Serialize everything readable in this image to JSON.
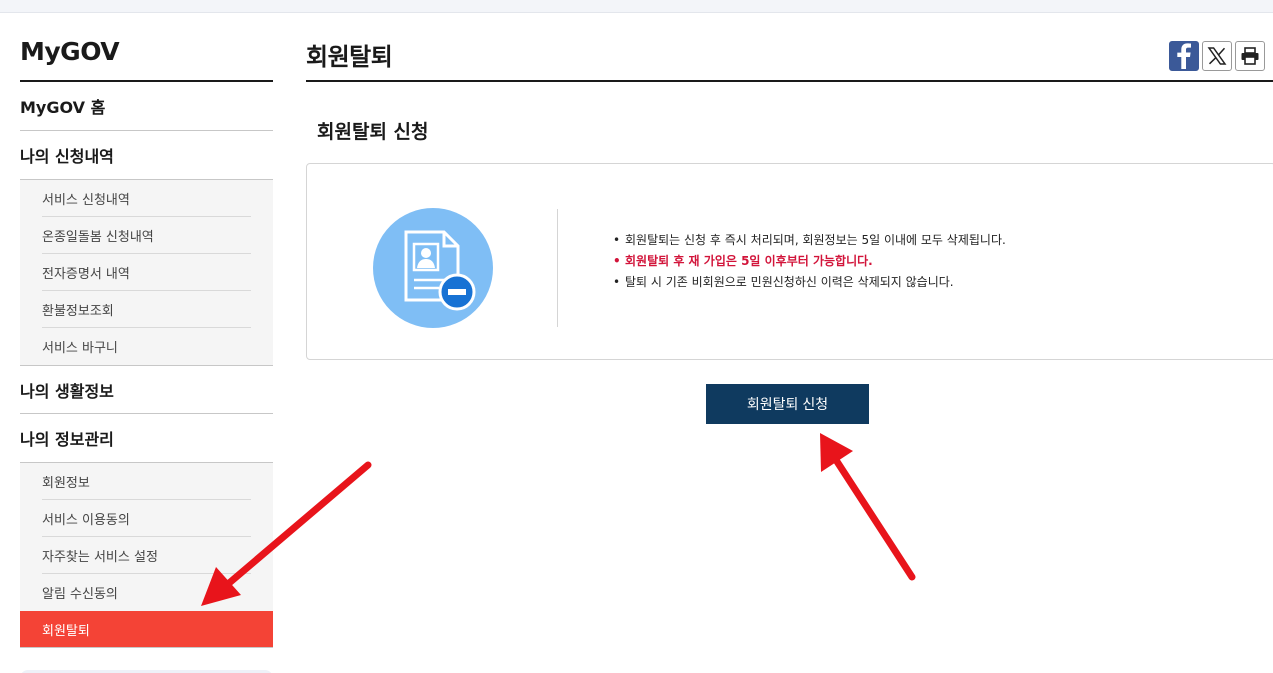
{
  "sidebar": {
    "title": "MyGOV",
    "home": "MyGOV 홈",
    "group1": {
      "label": "나의 신청내역",
      "items": [
        "서비스 신청내역",
        "온종일돌봄 신청내역",
        "전자증명서 내역",
        "환불정보조회",
        "서비스 바구니"
      ]
    },
    "group2": {
      "label": "나의 생활정보"
    },
    "group3": {
      "label": "나의 정보관리",
      "items": [
        "회원정보",
        "서비스 이용동의",
        "자주찾는 서비스 설정",
        "알림 수신동의"
      ],
      "active": "회원탈퇴"
    }
  },
  "main": {
    "title": "회원탈퇴",
    "section_title": "회원탈퇴 신청",
    "notes": [
      "회원탈퇴는 신청 후 즉시 처리되며, 회원정보는 5일 이내에 모두 삭제됩니다.",
      "회원탈퇴 후 재 가입은 5일 이후부터 가능합니다.",
      "탈퇴 시 기존 비회원으로 민원신청하신 이력은 삭제되지 않습니다."
    ],
    "submit_label": "회원탈퇴 신청"
  },
  "share": {
    "icons": [
      "facebook-icon",
      "x-icon",
      "print-icon"
    ]
  },
  "colors": {
    "active_menu": "#f44336",
    "submit_button": "#0f3a5f",
    "warning_text": "#d2143a",
    "icon_circle": "#7fbef5",
    "annotation_arrow": "#e8141b"
  }
}
